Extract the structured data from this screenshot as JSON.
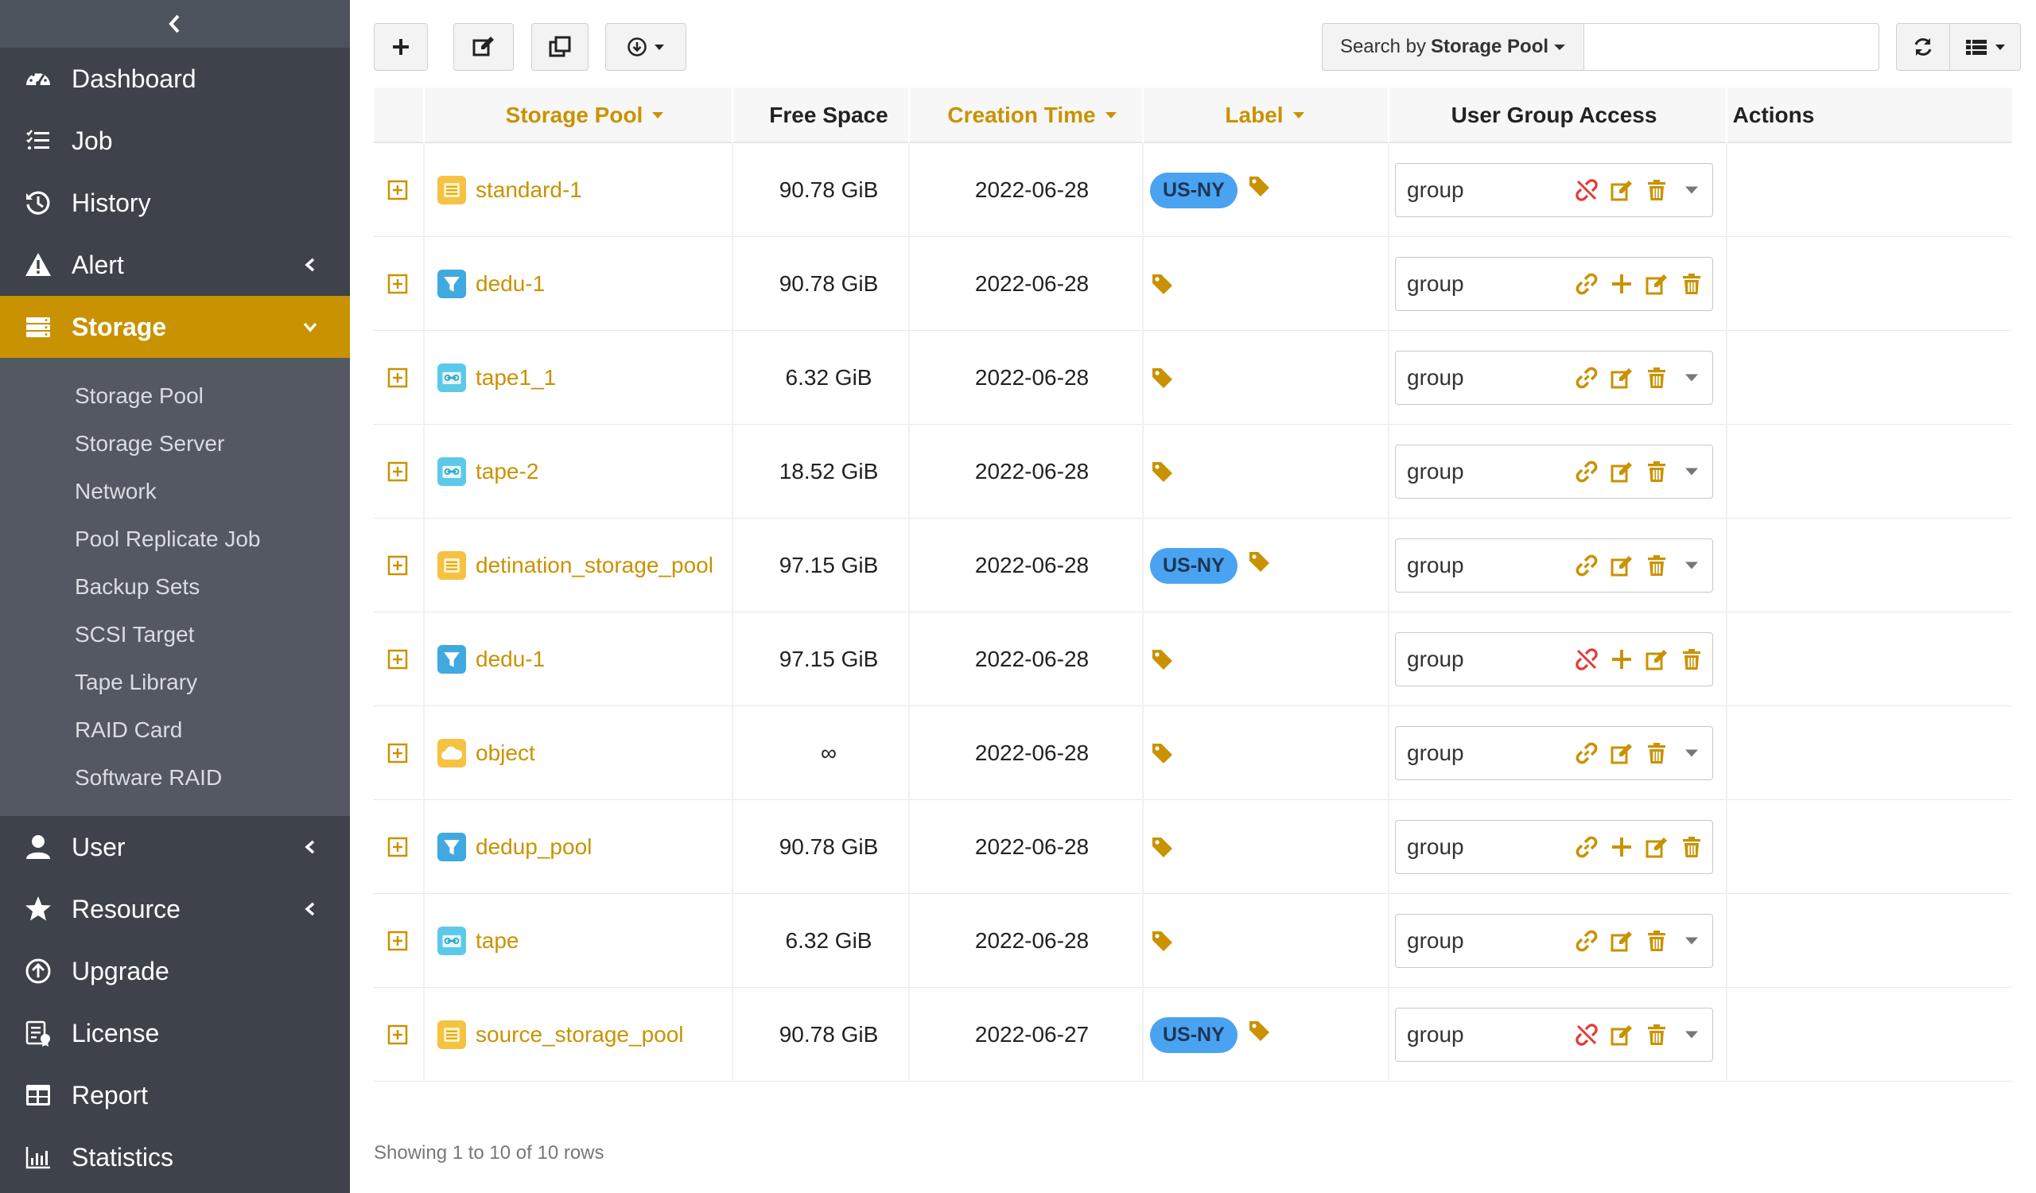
{
  "colors": {
    "accent": "#c99200",
    "sidebar": "#3d424b",
    "submenu": "#535862",
    "badge": "#4aa3f0",
    "unlink": "#e53935"
  },
  "sidebar": {
    "items": [
      {
        "label": "Dashboard",
        "icon": "tachometer-icon",
        "chevron": null
      },
      {
        "label": "Job",
        "icon": "list-icon",
        "chevron": null
      },
      {
        "label": "History",
        "icon": "history-icon",
        "chevron": null
      },
      {
        "label": "Alert",
        "icon": "warning-icon",
        "chevron": "left"
      },
      {
        "label": "Storage",
        "icon": "server-icon",
        "chevron": "down",
        "active": true
      }
    ],
    "storage_submenu": [
      "Storage Pool",
      "Storage Server",
      "Network",
      "Pool Replicate Job",
      "Backup Sets",
      "SCSI Target",
      "Tape Library",
      "RAID Card",
      "Software RAID"
    ],
    "bottom_items": [
      {
        "label": "User",
        "icon": "user-icon",
        "chevron": "left"
      },
      {
        "label": "Resource",
        "icon": "star-icon",
        "chevron": "left"
      },
      {
        "label": "Upgrade",
        "icon": "upgrade-icon",
        "chevron": null
      },
      {
        "label": "License",
        "icon": "license-icon",
        "chevron": null
      },
      {
        "label": "Report",
        "icon": "table-icon",
        "chevron": null
      },
      {
        "label": "Statistics",
        "icon": "bar-chart-icon",
        "chevron": null
      }
    ]
  },
  "toolbar": {
    "search_prefix": "Search by",
    "search_field": "Storage Pool",
    "search_value": ""
  },
  "table": {
    "columns": {
      "storage_pool": "Storage Pool",
      "free_space": "Free Space",
      "creation_time": "Creation Time",
      "label": "Label",
      "user_group_access": "User Group Access",
      "actions": "Actions"
    },
    "rows": [
      {
        "name": "standard-1",
        "type": "standard",
        "free": "90.78 GiB",
        "time": "2022-06-28",
        "badge": "US-NY",
        "group": "group",
        "link": "unlink",
        "add": false
      },
      {
        "name": "dedu-1",
        "type": "dedup",
        "free": "90.78 GiB",
        "time": "2022-06-28",
        "badge": "",
        "group": "group",
        "link": "link",
        "add": true
      },
      {
        "name": "tape1_1",
        "type": "tape",
        "free": "6.32 GiB",
        "time": "2022-06-28",
        "badge": "",
        "group": "group",
        "link": "link",
        "add": false
      },
      {
        "name": "tape-2",
        "type": "tape",
        "free": "18.52 GiB",
        "time": "2022-06-28",
        "badge": "",
        "group": "group",
        "link": "link",
        "add": false
      },
      {
        "name": "detination_storage_pool",
        "type": "standard",
        "free": "97.15 GiB",
        "time": "2022-06-28",
        "badge": "US-NY",
        "group": "group",
        "link": "link",
        "add": false
      },
      {
        "name": "dedu-1",
        "type": "dedup",
        "free": "97.15 GiB",
        "time": "2022-06-28",
        "badge": "",
        "group": "group",
        "link": "unlink",
        "add": true
      },
      {
        "name": "object",
        "type": "object",
        "free": "∞",
        "time": "2022-06-28",
        "badge": "",
        "group": "group",
        "link": "link",
        "add": false
      },
      {
        "name": "dedup_pool",
        "type": "dedup",
        "free": "90.78 GiB",
        "time": "2022-06-28",
        "badge": "",
        "group": "group",
        "link": "link",
        "add": true
      },
      {
        "name": "tape",
        "type": "tape",
        "free": "6.32 GiB",
        "time": "2022-06-28",
        "badge": "",
        "group": "group",
        "link": "link",
        "add": false
      },
      {
        "name": "source_storage_pool",
        "type": "standard",
        "free": "90.78 GiB",
        "time": "2022-06-27",
        "badge": "US-NY",
        "group": "group",
        "link": "unlink",
        "add": false
      }
    ]
  },
  "footer": {
    "text": "Showing 1 to 10 of 10 rows"
  }
}
